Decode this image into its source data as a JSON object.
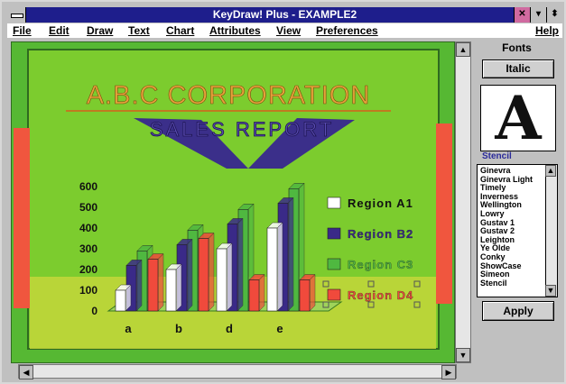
{
  "window": {
    "title": "KeyDraw! Plus - EXAMPLE2",
    "help_label": "Help"
  },
  "menu": [
    "File",
    "Edit",
    "Draw",
    "Text",
    "Chart",
    "Attributes",
    "View",
    "Preferences"
  ],
  "canvas": {
    "title": "A.B.C CORPORATION",
    "subtitle": "SALES REPORT"
  },
  "fonts_panel": {
    "title": "Fonts",
    "style_button": "Italic",
    "preview_glyph": "A",
    "selected_font": "Stencil",
    "font_list": [
      "Ginevra",
      "Ginevra Light",
      "Timely",
      "Inverness",
      "Wellington",
      "Lowry",
      "Gustav 1",
      "Gustav 2",
      "Leighton",
      "Ye Olde",
      "Conky",
      "ShowCase",
      "Simeon",
      "Stencil"
    ],
    "apply_button": "Apply"
  },
  "chart_data": {
    "type": "bar",
    "categories": [
      "a",
      "b",
      "d",
      "e"
    ],
    "yticks": [
      0,
      100,
      200,
      300,
      400,
      500,
      600
    ],
    "ylim": [
      0,
      600
    ],
    "series": [
      {
        "name": "Region A1",
        "color": "#ffffff",
        "values": [
          100,
          200,
          300,
          400
        ]
      },
      {
        "name": "Region B2",
        "color": "#3a2a88",
        "values": [
          220,
          320,
          420,
          520
        ]
      },
      {
        "name": "Region C3",
        "color": "#4fb840",
        "values": [
          290,
          390,
          490,
          590
        ]
      },
      {
        "name": "Region D4",
        "color": "#f04a3c",
        "values": [
          250,
          350,
          150,
          150
        ]
      }
    ]
  }
}
